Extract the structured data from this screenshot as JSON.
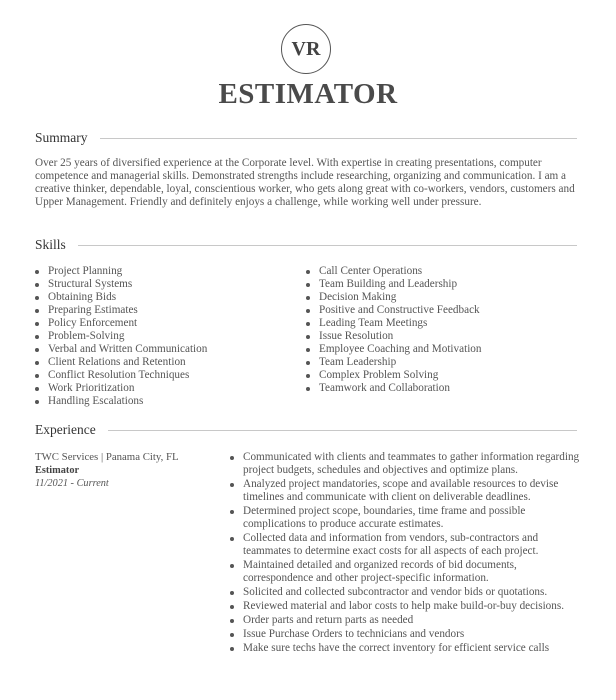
{
  "header": {
    "initials": "VR",
    "title": "ESTIMATOR"
  },
  "sections": {
    "summary": {
      "heading": "Summary",
      "text": "Over 25 years of diversified experience at the Corporate level. With expertise in creating presentations, computer competence and managerial skills. Demonstrated strengths include researching, organizing and communication. I am a creative thinker, dependable, loyal, conscientious worker, who gets along great with co-workers, vendors, customers and Upper Management. Friendly and definitely enjoys a challenge, while working well under pressure."
    },
    "skills": {
      "heading": "Skills",
      "left": [
        "Project Planning",
        "Structural Systems",
        "Obtaining Bids",
        "Preparing Estimates",
        "Policy Enforcement",
        "Problem-Solving",
        "Verbal and Written Communication",
        "Client Relations and Retention",
        "Conflict Resolution Techniques",
        "Work Prioritization",
        "Handling Escalations"
      ],
      "right": [
        "Call Center Operations",
        "Team Building and Leadership",
        "Decision Making",
        "Positive and Constructive Feedback",
        "Leading Team Meetings",
        "Issue Resolution",
        "Employee Coaching and Motivation",
        "Team Leadership",
        "Complex Problem Solving",
        "Teamwork and Collaboration"
      ]
    },
    "experience": {
      "heading": "Experience",
      "jobs": [
        {
          "company_location": "TWC Services | Panama City, FL",
          "position": "Estimator",
          "dates": "11/2021 - Current",
          "bullets": [
            "Communicated with clients and teammates to gather information regarding project budgets, schedules and objectives and optimize plans.",
            "Analyzed project mandatories, scope and available resources to devise timelines and communicate with client on deliverable deadlines.",
            "Determined project scope, boundaries, time frame and possible complications to produce accurate estimates.",
            "Collected data and information from vendors, sub-contractors and teammates to determine exact costs for all aspects of each project.",
            "Maintained detailed and organized records of bid documents, correspondence and other project-specific information.",
            "Solicited and collected subcontractor and vendor bids or quotations.",
            "Reviewed material and labor costs to help make build-or-buy decisions.",
            "Order parts and return parts as needed",
            "Issue Purchase Orders to technicians and vendors",
            "Make sure techs have the correct inventory for efficient service calls"
          ]
        }
      ]
    }
  }
}
